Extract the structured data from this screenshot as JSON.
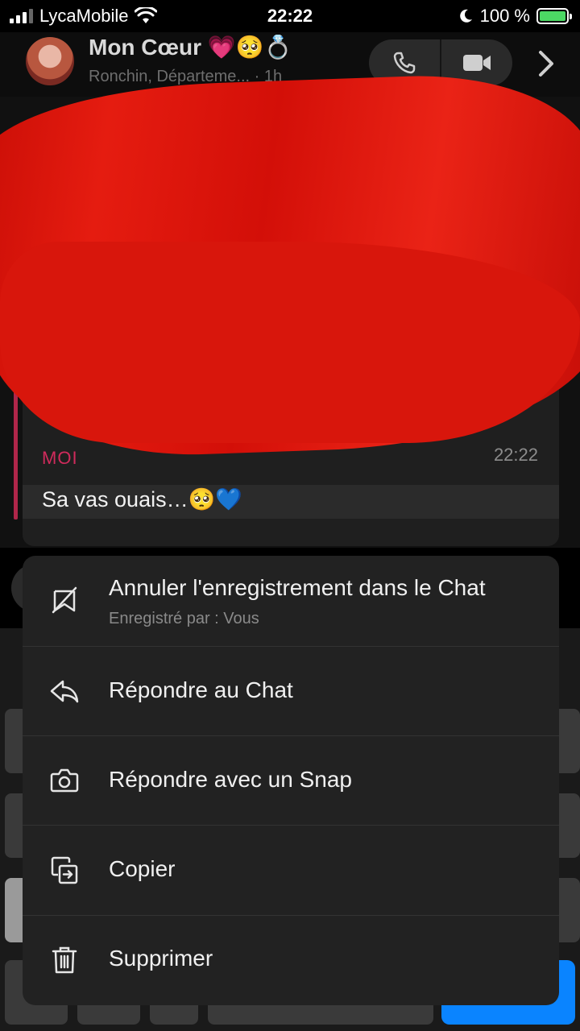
{
  "status_bar": {
    "carrier": "LycaMobile",
    "time": "22:22",
    "battery": "100 %"
  },
  "header": {
    "name": "Mon Cœur 💗🥺💍",
    "subtitle": "Ronchin, Départeme... · 1h"
  },
  "message": {
    "sender": "MOI",
    "time": "22:22",
    "text": "Sa vas ouais…🥺💙"
  },
  "context_menu": {
    "items": [
      {
        "label": "Annuler l'enregistrement dans le Chat",
        "sub": "Enregistré par : Vous",
        "icon": "unsave-icon"
      },
      {
        "label": "Répondre au Chat",
        "icon": "reply-icon"
      },
      {
        "label": "Répondre avec un Snap",
        "icon": "camera-icon"
      },
      {
        "label": "Copier",
        "icon": "copy-icon"
      },
      {
        "label": "Supprimer",
        "icon": "trash-icon"
      }
    ]
  },
  "colors": {
    "accent_pink": "#d02b5c",
    "redaction_red": "#e51c10",
    "menu_bg": "#222222",
    "battery_green": "#4cd964",
    "keyboard_blue": "#0a84ff"
  }
}
